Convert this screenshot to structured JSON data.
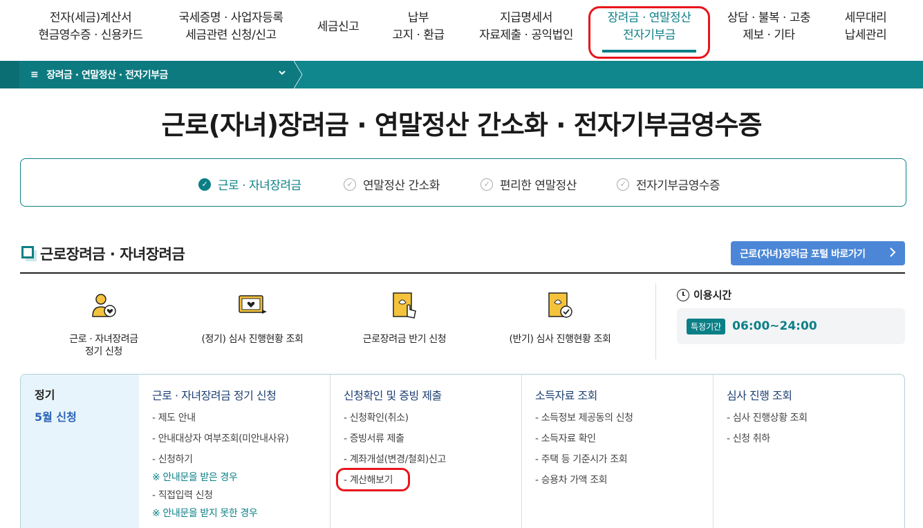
{
  "nav": {
    "items": [
      {
        "line1": "전자(세금)계산서",
        "line2": "현금영수증 · 신용카드"
      },
      {
        "line1": "국세증명 · 사업자등록",
        "line2": "세금관련 신청/신고"
      },
      {
        "line1": "세금신고",
        "line2": ""
      },
      {
        "line1": "납부",
        "line2": "고지 · 환급"
      },
      {
        "line1": "지급명세서",
        "line2": "자료제출 · 공익법인"
      },
      {
        "line1": "장려금 · 연말정산",
        "line2": "전자기부금"
      },
      {
        "line1": "상담 · 불복 · 고충",
        "line2": "제보 · 기타"
      },
      {
        "line1": "세무대리",
        "line2": "납세관리"
      }
    ],
    "active_index": 5
  },
  "breadcrumb": {
    "menu_icon": "≡",
    "label": "장려금 · 연말정산 · 전자기부금",
    "chevron_icon": "chevron-down-icon"
  },
  "page_title": "근로(자녀)장려금 · 연말정산 간소화 · 전자기부금영수증",
  "tabs": [
    {
      "label": "근로 · 자녀장려금",
      "active": true
    },
    {
      "label": "연말정산 간소화",
      "active": false
    },
    {
      "label": "편리한 연말정산",
      "active": false
    },
    {
      "label": "전자기부금영수증",
      "active": false
    }
  ],
  "section": {
    "title": "근로장려금 · 자녀장려금",
    "portal_button": "근로(자녀)장려금 포털 바로가기"
  },
  "quick_links": [
    {
      "line1": "근로 · 자녀장려금",
      "line2": "정기 신청",
      "icon": "person-heart-icon"
    },
    {
      "line1": "(정기) 심사 진행현황 조회",
      "line2": "",
      "icon": "monitor-heart-icon"
    },
    {
      "line1": "근로장려금 반기 신청",
      "line2": "",
      "icon": "document-hand-icon"
    },
    {
      "line1": "(반기) 심사 진행현황 조회",
      "line2": "",
      "icon": "document-check-icon"
    }
  ],
  "usage_time": {
    "title": "이용시간",
    "badge": "특정기간",
    "value": "06:00~24:00"
  },
  "table": {
    "left_title": "정기",
    "left_sub": "5월 신청",
    "columns": [
      {
        "header": "근로 · 자녀장려금 정기 신청",
        "items": [
          "- 제도 안내",
          "- 안내대상자 여부조회(미안내사유)",
          "- 신청하기",
          "※ 안내문을 받은 경우",
          "- 직접입력 신청",
          "※ 안내문을 받지 못한 경우"
        ]
      },
      {
        "header": "신청확인 및 증빙 제출",
        "items": [
          "- 신청확인(취소)",
          "- 증빙서류 제출",
          "- 계좌개설(변경/철회)신고",
          "- 계산해보기"
        ]
      },
      {
        "header": "소득자료 조회",
        "items": [
          "- 소득정보 제공동의 신청",
          "- 소득자료 확인",
          "- 주택 등 기준시가 조회",
          "- 승용차 가액 조회"
        ]
      },
      {
        "header": "심사 진행 조회",
        "items": [
          "- 심사 진행상황 조회",
          "- 신청 취하"
        ]
      }
    ]
  },
  "colors": {
    "accent": "#0b7f86",
    "bar": "#10868d",
    "button": "#4b87d6",
    "highlight": "#e8141b",
    "link_blue": "#2b63b6"
  }
}
